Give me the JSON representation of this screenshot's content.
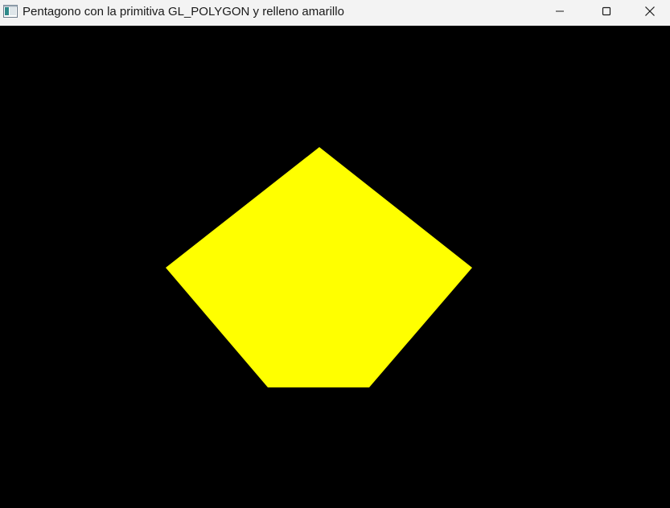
{
  "window": {
    "title": "Pentagono con la primitiva GL_POLYGON y relleno amarillo",
    "controls": {
      "minimize_icon": "minimize-icon",
      "maximize_icon": "maximize-icon",
      "close_icon": "close-icon"
    }
  },
  "canvas": {
    "background_color": "#000000",
    "shape": {
      "primitive": "GL_POLYGON",
      "sides": 5,
      "fill_color": "#ffff00"
    }
  }
}
